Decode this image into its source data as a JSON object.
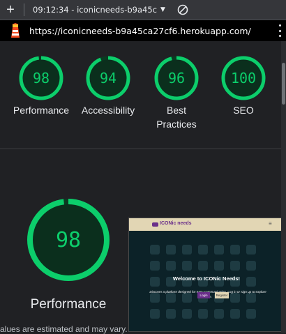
{
  "devtools": {
    "session_label": "09:12:34 - iconicneeds-b9a45c",
    "url": "https://iconicneeds-b9a45ca27cf6.herokuapp.com/"
  },
  "scores": [
    {
      "value": 98,
      "label": "Performance"
    },
    {
      "value": 94,
      "label": "Accessibility"
    },
    {
      "value": 96,
      "label": "Best Practices"
    },
    {
      "value": 100,
      "label": "SEO"
    }
  ],
  "performance_detail": {
    "score": 98,
    "label": "Performance",
    "footnote": "alues are estimated and may vary. The"
  },
  "screenshot_preview": {
    "brand": "ICONic needs",
    "heading": "Welcome to ICONic Needs!",
    "subtext": "Discover a platform designed for easy communication. Log in or sign up to explore more.",
    "login_label": "Login",
    "register_label": "Register"
  },
  "colors": {
    "pass_green": "#0cce6b",
    "ring_bg": "#0b3a22",
    "page_bg": "#202124"
  }
}
